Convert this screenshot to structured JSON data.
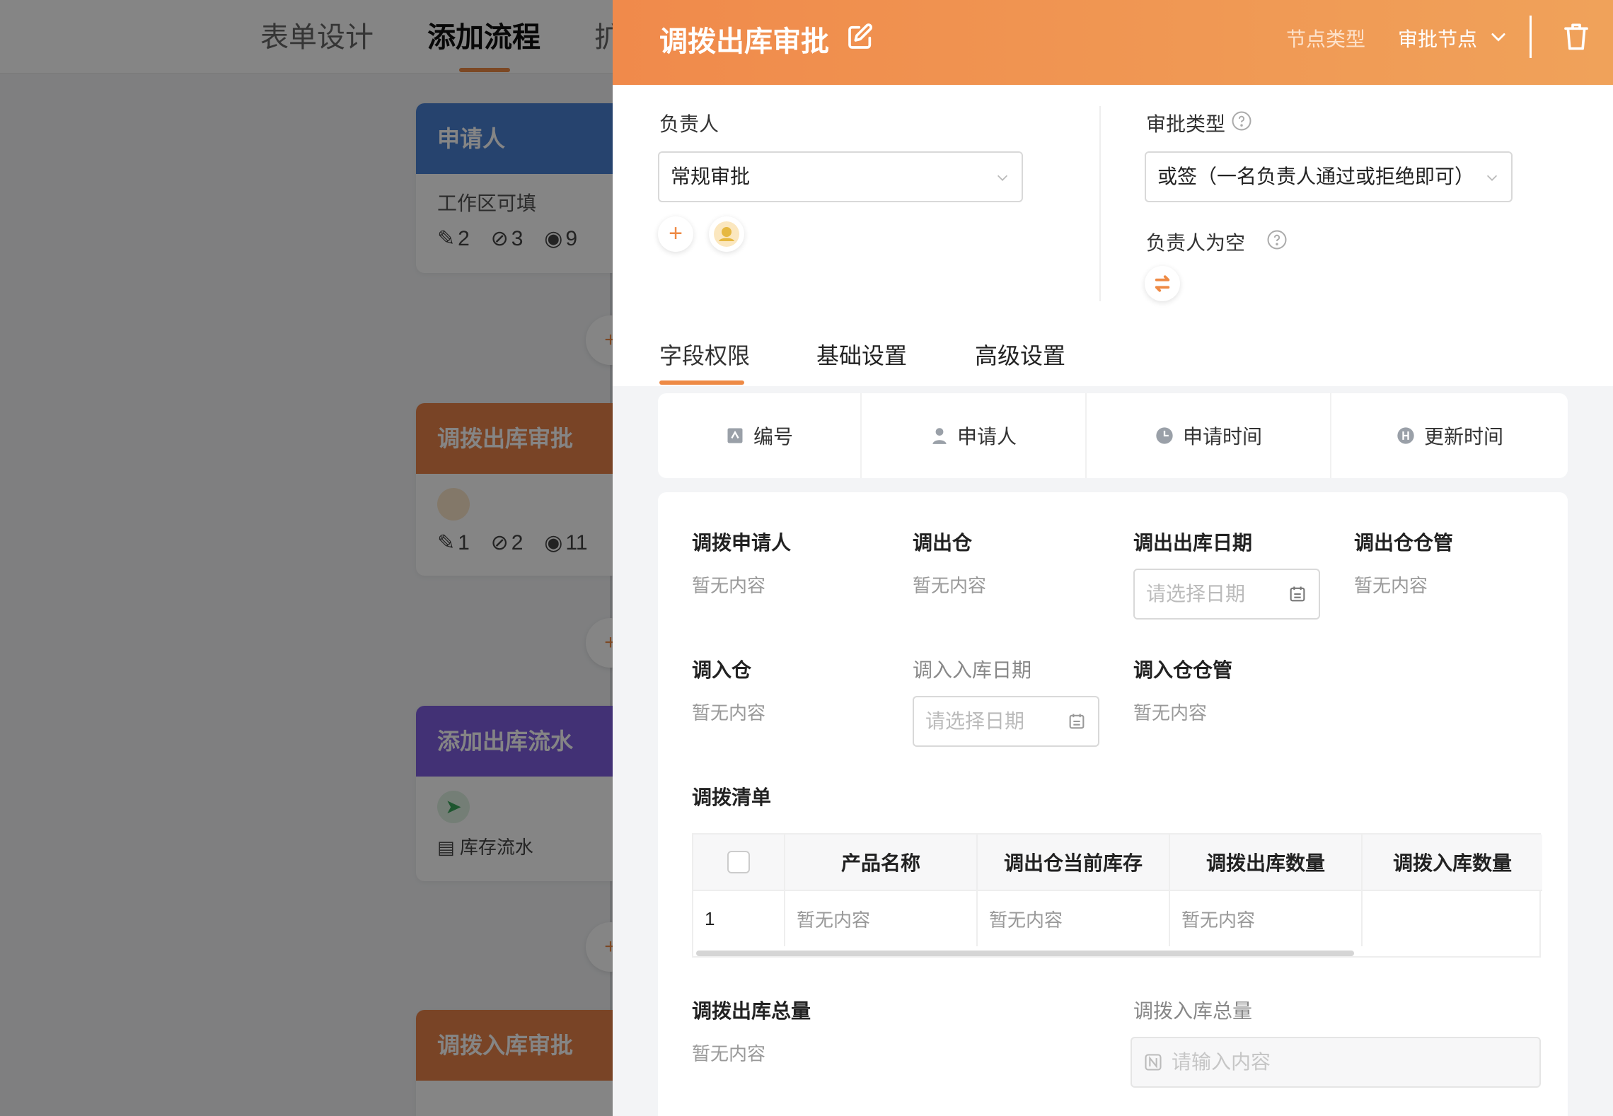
{
  "background": {
    "tabs": [
      "表单设计",
      "添加流程",
      "扩"
    ],
    "cards": [
      {
        "title": "申请人",
        "color": "#4a80d4",
        "sub": "工作区可填",
        "stats": [
          "2",
          "3",
          "9"
        ]
      },
      {
        "title": "调拨出库审批",
        "color": "#e8834a",
        "stats": [
          "1",
          "2",
          "11"
        ]
      },
      {
        "title": "添加出库流水",
        "color": "#7f5fe0",
        "sub": "库存流水"
      },
      {
        "title": "调拨入库审批",
        "color": "#e8834a"
      }
    ],
    "add_label": "+"
  },
  "drawer": {
    "title": "调拨出库审批",
    "node_type_label": "节点类型",
    "node_type_value": "审批节点",
    "owner_label": "负责人",
    "owner_select": "常规审批",
    "add_label": "+",
    "approval_type_label": "审批类型",
    "approval_type_select": "或签（一名负责人通过或拒绝即可）",
    "empty_owner_label": "负责人为空",
    "tabs": [
      "字段权限",
      "基础设置",
      "高级设置"
    ],
    "system_fields": [
      "编号",
      "申请人",
      "申请时间",
      "更新时间"
    ],
    "form": {
      "empty": "暂无内容",
      "date_placeholder": "请选择日期",
      "input_placeholder": "请输入内容",
      "fields": {
        "applicant": "调拨申请人",
        "out_warehouse": "调出仓",
        "out_date": "调出出库日期",
        "out_manager": "调出仓仓管",
        "in_warehouse": "调入仓",
        "in_date": "调入入库日期",
        "in_manager": "调入仓仓管",
        "list": "调拨清单",
        "out_total": "调拨出库总量",
        "in_total": "调拨入库总量"
      },
      "table": {
        "headers": [
          "产品名称",
          "调出仓当前库存",
          "调拨出库数量",
          "调拨入库数量"
        ],
        "row_index": "1"
      }
    }
  },
  "colors": {
    "accent": "#ee8a45",
    "header_start": "#f08a4b",
    "header_end": "#f0a25a"
  }
}
